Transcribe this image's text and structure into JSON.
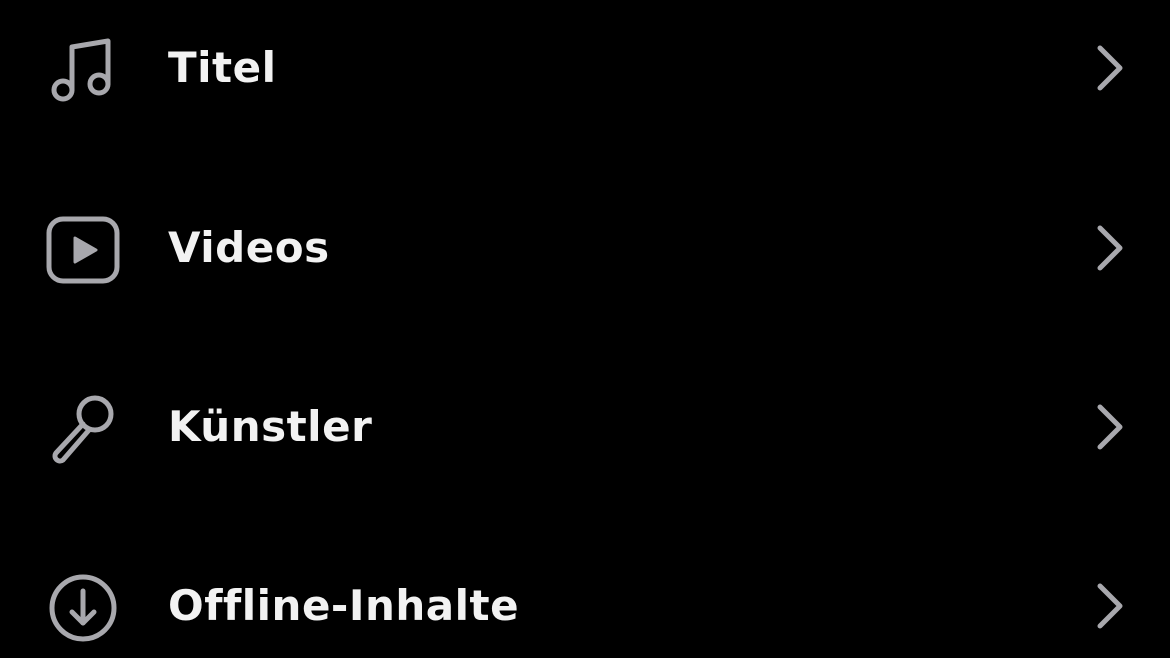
{
  "colors": {
    "background": "#000000",
    "text": "#f2f2f2",
    "icon": "#a8a8ad",
    "chevron": "#a8a8ad"
  },
  "menu": {
    "items": [
      {
        "label": "Titel",
        "icon": "music-note-icon"
      },
      {
        "label": "Videos",
        "icon": "video-play-icon"
      },
      {
        "label": "Künstler",
        "icon": "microphone-icon"
      },
      {
        "label": "Offline-Inhalte",
        "icon": "download-circle-icon"
      }
    ]
  }
}
